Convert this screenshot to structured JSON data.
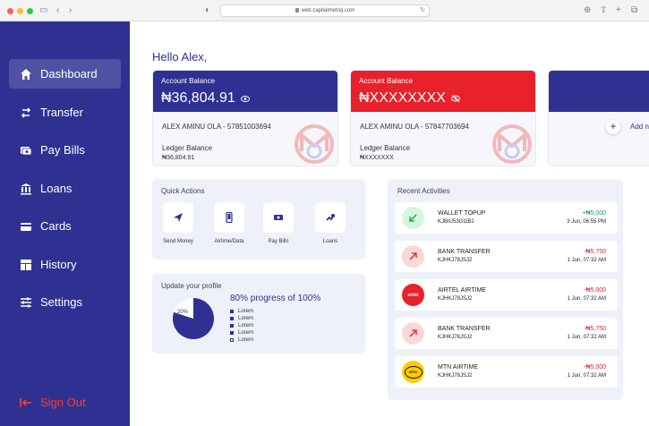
{
  "browser": {
    "url": "web.capitalmetriq.com"
  },
  "colors": {
    "primary": "#2e3192",
    "danger": "#e8212b",
    "success": "#1a9a4a",
    "signout": "#ff3b30",
    "panel": "#eef0fa"
  },
  "sidebar": {
    "items": [
      {
        "label": "Dashboard",
        "icon": "home-icon",
        "active": true
      },
      {
        "label": "Transfer",
        "icon": "transfer-icon",
        "active": false
      },
      {
        "label": "Pay Bills",
        "icon": "bill-icon",
        "active": false
      },
      {
        "label": "Loans",
        "icon": "bank-icon",
        "active": false
      },
      {
        "label": "Cards",
        "icon": "card-icon",
        "active": false
      },
      {
        "label": "History",
        "icon": "history-icon",
        "active": false
      },
      {
        "label": "Settings",
        "icon": "sliders-icon",
        "active": false
      }
    ],
    "signout": "Sign Out"
  },
  "greeting": "Hello Alex,",
  "accounts": [
    {
      "title": "Account Balance",
      "balance": "₦36,804.91",
      "holder": "ALEX AMINU OLA  -  57851003694",
      "ledger_label": "Ledger Balance",
      "ledger_value": "₦36,804.91",
      "color": "#2e3192"
    },
    {
      "title": "Account Balance",
      "balance": "₦XXXXXXXX",
      "holder": "ALEX AMINU OLA  -  57847703694",
      "ledger_label": "Ledger Balance",
      "ledger_value": "₦XXXXXXX",
      "color": "#e8212b"
    }
  ],
  "add_account": {
    "label": "Add n"
  },
  "quick_actions": {
    "title": "Quick Actions",
    "items": [
      {
        "label": "Send Money",
        "icon": "send-icon"
      },
      {
        "label": "Airtime/Data",
        "icon": "phone-icon"
      },
      {
        "label": "Pay Bills",
        "icon": "bill-icon"
      },
      {
        "label": "Loans",
        "icon": "loan-icon"
      }
    ]
  },
  "profile": {
    "title": "Update your profile",
    "progress_text": "80% progress of 100%",
    "pie_label": "20%",
    "progress_fraction": 0.8,
    "legend": [
      "Lorem",
      "Lorem",
      "Lorem",
      "Lorem",
      "Lorem"
    ]
  },
  "recent": {
    "title": "Recent Activities",
    "items": [
      {
        "title": "WALLET TOPUP",
        "ref": "KJBIU53GI2B2",
        "amount": "+₦5,000",
        "date": "3 Jun, 06:55 PM",
        "type": "credit",
        "icon": "arrow-down-left-icon"
      },
      {
        "title": "BANK TRANSFER",
        "ref": "KJHKJ78JSJ2",
        "amount": "-₦5,750",
        "date": "1 Jun, 07:32 AM",
        "type": "debit",
        "icon": "arrow-up-right-icon"
      },
      {
        "title": "AIRTEL AIRTIME",
        "ref": "KJHKJ78JSJ2",
        "amount": "-₦5,000",
        "date": "1 Jun, 07:32 AM",
        "type": "debit",
        "icon": "airtel-logo",
        "logo_text": "airtel"
      },
      {
        "title": "BANK TRANSFER",
        "ref": "KJHKJ78JSJ2",
        "amount": "-₦5,750",
        "date": "1 Jun, 07:32 AM",
        "type": "debit",
        "icon": "arrow-up-right-icon"
      },
      {
        "title": "MTN AIRTIME",
        "ref": "KJHKJ78JSJ2",
        "amount": "-₦5,000",
        "date": "1 Jun, 07:32 AM",
        "type": "debit",
        "icon": "mtn-logo",
        "logo_text": "MTN"
      }
    ]
  }
}
